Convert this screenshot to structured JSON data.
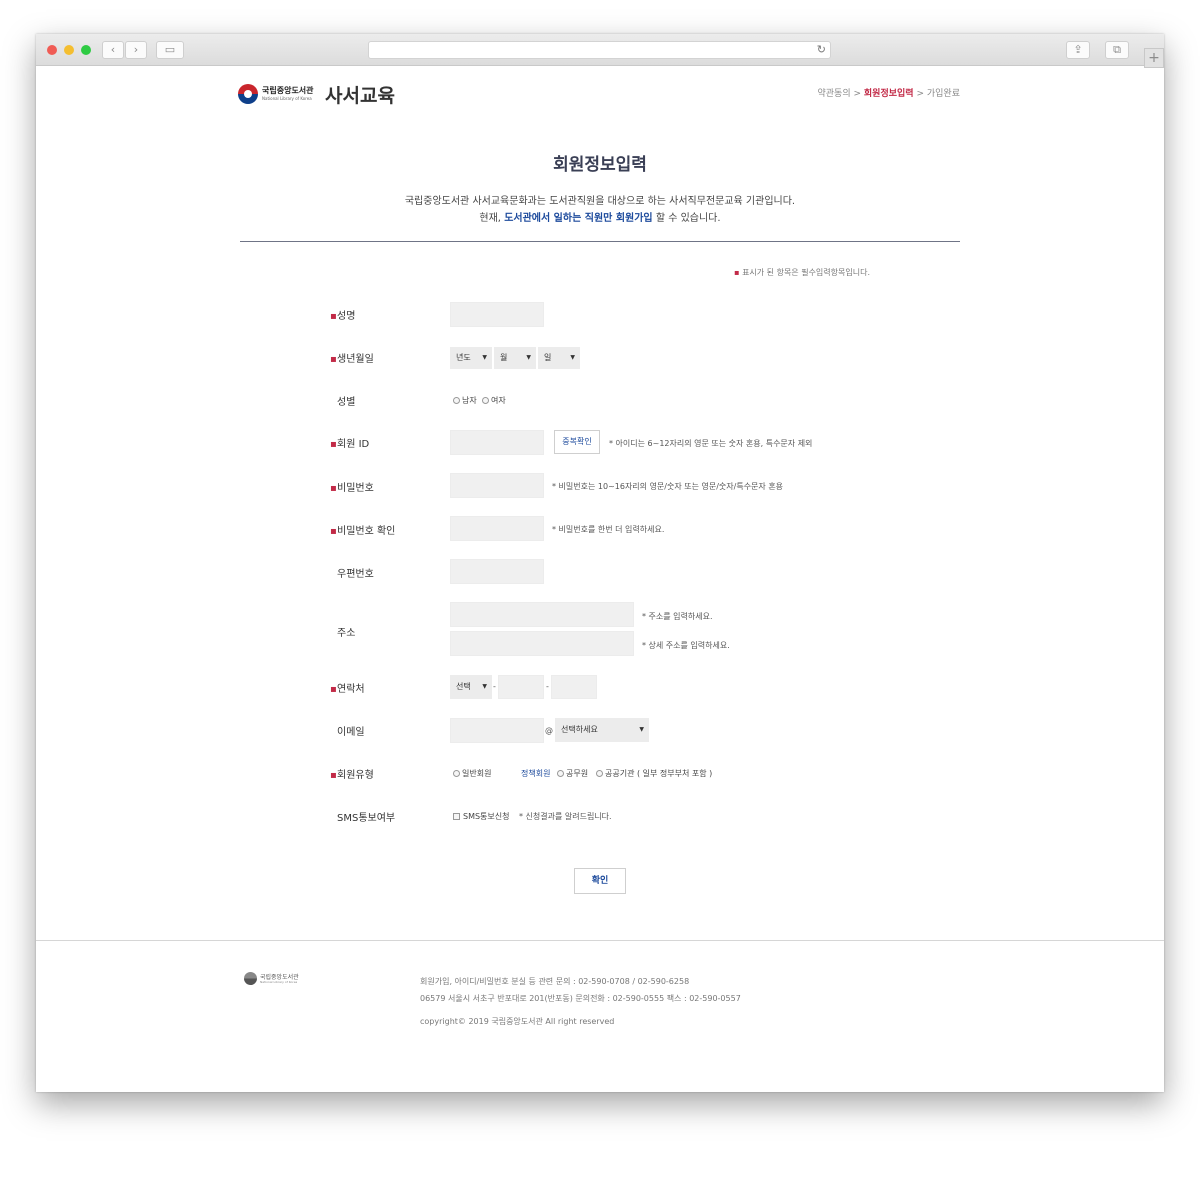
{
  "browser": {
    "back": "‹",
    "forward": "›",
    "sidebar": "▭",
    "reload": "↻",
    "share": "⇪",
    "tabs": "⧉",
    "new_tab": "+"
  },
  "header": {
    "logo_kr": "국립중앙도서관",
    "logo_en": "National Library of Korea",
    "site_title": "사서교육",
    "steps": {
      "step1": "약관동의 >",
      "step2": "회원정보입력",
      "step3": "> 가입완료"
    }
  },
  "intro": {
    "title": "회원정보입력",
    "desc1": "국립중앙도서관 사서교육문화과는 도서관직원을 대상으로 하는 사서직무전문교육 기관입니다.",
    "desc2_pre": "현재,",
    "desc2_hl": "도서관에서 일하는 직원만 회원가입",
    "desc2_post": "할 수 있습니다."
  },
  "required_note": {
    "bullet": "▪",
    "text": "표시가 된 항목은 필수입력항목입니다."
  },
  "bullet": "▪",
  "form": {
    "name_label": "성명",
    "birth_label": "생년월일",
    "birth_year": "년도",
    "birth_month": "월",
    "birth_day": "일",
    "gender_label": "성별",
    "gender_male": "남자",
    "gender_female": "여자",
    "id_label": "회원 ID",
    "id_check_button": "중복확인",
    "id_note": "* 아이디는 6~12자리의 영문 또는 숫자 혼용, 특수문자 제외",
    "pw_label": "비밀번호",
    "pw_note": "* 비밀번호는 10~16자리의 영문/숫자 또는 영문/숫자/특수문자 혼용",
    "pw_confirm_label": "비밀번호 확인",
    "pw_confirm_note": "* 비밀번호를 한번 더 입력하세요.",
    "zip_label": "우편번호",
    "addr_label": "주소",
    "addr_note1": "* 주소를 입력하세요.",
    "addr_note2": "* 상세 주소를 입력하세요.",
    "phone_label": "연락처",
    "phone_select": "선택",
    "phone_sep": "-",
    "email_label": "이메일",
    "email_at": "@",
    "email_select": "선택하세요",
    "type_label": "회원유형",
    "type_general": "일반회원",
    "type_policy": "정책회원",
    "type_civil": "공무원",
    "type_public": "공공기관 ( 일부 정부부처 포함 )",
    "sms_label": "SMS통보여부",
    "sms_option": "SMS통보신청",
    "sms_note": "* 신청결과를 알려드립니다.",
    "submit": "확인",
    "dropdown_arrow": "▼"
  },
  "footer": {
    "logo_kr": "국립중앙도서관",
    "logo_en": "National Library of Korea",
    "line1": "회원가입, 아이디/비밀번호 분실 등 관련 문의 : 02-590-0708 / 02-590-6258",
    "line2": "06579 서울시 서초구 반포대로 201(반포동) 문의전화 : 02-590-0555 팩스 : 02-590-0557",
    "copyright": "copyright© 2019 국립중앙도서관 All right reserved"
  }
}
